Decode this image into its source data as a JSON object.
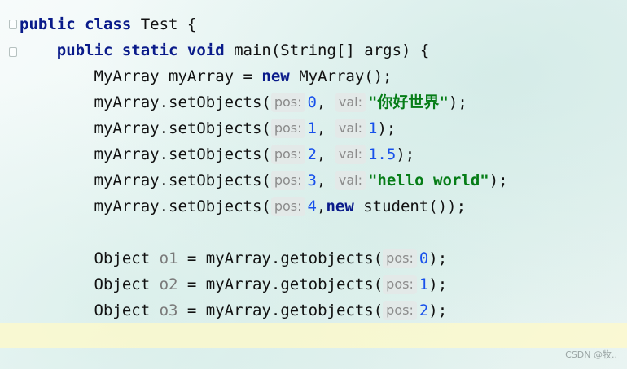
{
  "editor": {
    "lines": [
      {
        "indent": "",
        "tokens": [
          {
            "t": "kw",
            "v": "public class"
          },
          {
            "t": "plain",
            "v": " Test {"
          }
        ]
      },
      {
        "indent": "    ",
        "tokens": [
          {
            "t": "kw",
            "v": "public static void"
          },
          {
            "t": "plain",
            "v": " main(String[] args) {"
          }
        ]
      },
      {
        "indent": "        ",
        "tokens": [
          {
            "t": "plain",
            "v": "MyArray myArray = "
          },
          {
            "t": "kw",
            "v": "new"
          },
          {
            "t": "plain",
            "v": " MyArray();"
          }
        ]
      },
      {
        "indent": "        ",
        "tokens": [
          {
            "t": "plain",
            "v": "myArray.setObjects("
          },
          {
            "t": "hint",
            "v": "pos:"
          },
          {
            "t": "num",
            "v": "0"
          },
          {
            "t": "plain",
            "v": ", "
          },
          {
            "t": "hint",
            "v": "val:"
          },
          {
            "t": "str",
            "v": "\"你好世界\""
          },
          {
            "t": "plain",
            "v": ");"
          }
        ]
      },
      {
        "indent": "        ",
        "tokens": [
          {
            "t": "plain",
            "v": "myArray.setObjects("
          },
          {
            "t": "hint",
            "v": "pos:"
          },
          {
            "t": "num",
            "v": "1"
          },
          {
            "t": "plain",
            "v": ", "
          },
          {
            "t": "hint",
            "v": "val:"
          },
          {
            "t": "num",
            "v": "1"
          },
          {
            "t": "plain",
            "v": ");"
          }
        ]
      },
      {
        "indent": "        ",
        "tokens": [
          {
            "t": "plain",
            "v": "myArray.setObjects("
          },
          {
            "t": "hint",
            "v": "pos:"
          },
          {
            "t": "num",
            "v": "2"
          },
          {
            "t": "plain",
            "v": ", "
          },
          {
            "t": "hint",
            "v": "val:"
          },
          {
            "t": "num",
            "v": "1.5"
          },
          {
            "t": "plain",
            "v": ");"
          }
        ]
      },
      {
        "indent": "        ",
        "tokens": [
          {
            "t": "plain",
            "v": "myArray.setObjects("
          },
          {
            "t": "hint",
            "v": "pos:"
          },
          {
            "t": "num",
            "v": "3"
          },
          {
            "t": "plain",
            "v": ", "
          },
          {
            "t": "hint",
            "v": "val:"
          },
          {
            "t": "str",
            "v": "\"hello world\""
          },
          {
            "t": "plain",
            "v": ");"
          }
        ]
      },
      {
        "indent": "        ",
        "tokens": [
          {
            "t": "plain",
            "v": "myArray.setObjects("
          },
          {
            "t": "hint",
            "v": "pos:"
          },
          {
            "t": "num",
            "v": "4"
          },
          {
            "t": "plain",
            "v": ","
          },
          {
            "t": "kw",
            "v": "new"
          },
          {
            "t": "plain",
            "v": " student());"
          }
        ]
      },
      {
        "indent": "",
        "tokens": []
      },
      {
        "indent": "        ",
        "tokens": [
          {
            "t": "plain",
            "v": "Object "
          },
          {
            "t": "unused",
            "v": "o1"
          },
          {
            "t": "plain",
            "v": " = myArray.getobjects("
          },
          {
            "t": "hint",
            "v": "pos:"
          },
          {
            "t": "num",
            "v": "0"
          },
          {
            "t": "plain",
            "v": ");"
          }
        ]
      },
      {
        "indent": "        ",
        "tokens": [
          {
            "t": "plain",
            "v": "Object "
          },
          {
            "t": "unused",
            "v": "o2"
          },
          {
            "t": "plain",
            "v": " = myArray.getobjects("
          },
          {
            "t": "hint",
            "v": "pos:"
          },
          {
            "t": "num",
            "v": "1"
          },
          {
            "t": "plain",
            "v": ");"
          }
        ]
      },
      {
        "indent": "        ",
        "tokens": [
          {
            "t": "plain",
            "v": "Object "
          },
          {
            "t": "unused",
            "v": "o3"
          },
          {
            "t": "plain",
            "v": " = myArray.getobjects("
          },
          {
            "t": "hint",
            "v": "pos:"
          },
          {
            "t": "num",
            "v": "2"
          },
          {
            "t": "plain",
            "v": ");"
          }
        ]
      }
    ]
  },
  "watermark": "CSDN @牧.."
}
